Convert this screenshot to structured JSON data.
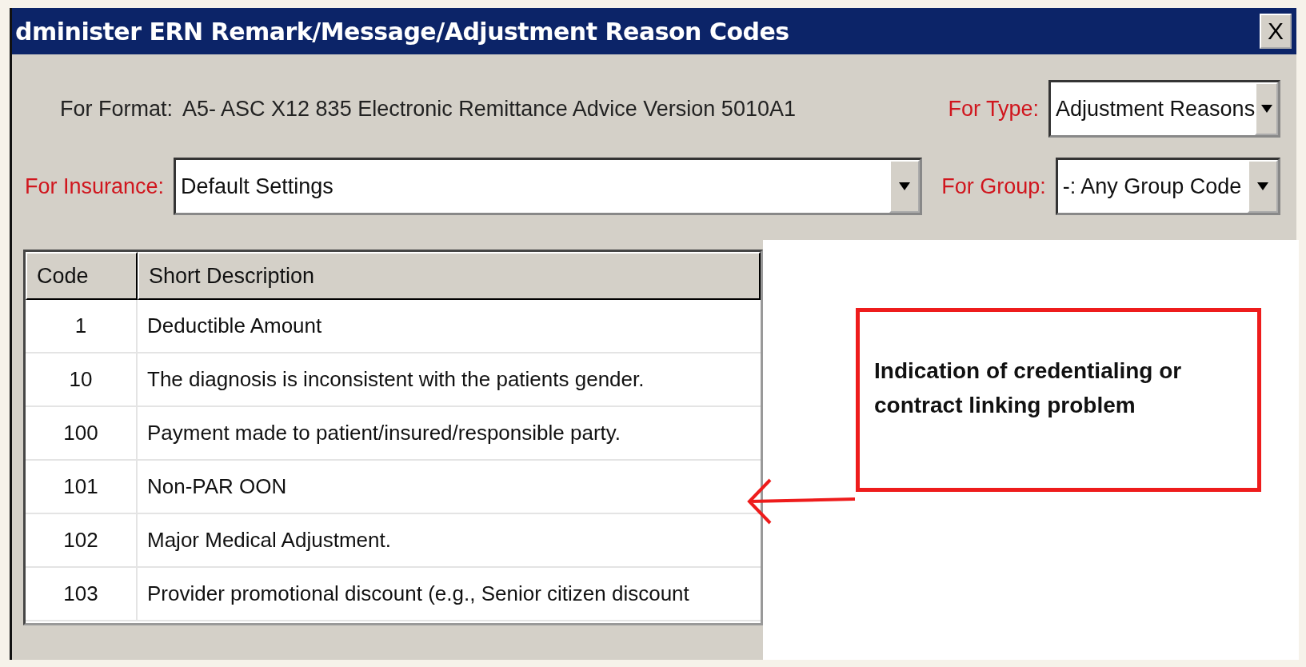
{
  "window": {
    "title": "dminister ERN Remark/Message/Adjustment Reason Codes",
    "close": "X"
  },
  "format": {
    "label": "For Format:",
    "value": "A5- ASC X12 835 Electronic Remittance Advice Version 5010A1"
  },
  "type": {
    "label": "For Type:",
    "value": "Adjustment Reasons"
  },
  "insurance": {
    "label": "For Insurance:",
    "value": "Default Settings"
  },
  "group": {
    "label": "For Group:",
    "value": "-: Any Group Code"
  },
  "table": {
    "columns": [
      "Code",
      "Short Description"
    ],
    "rows": [
      {
        "code": "1",
        "description": "Deductible Amount"
      },
      {
        "code": "10",
        "description": "The diagnosis is inconsistent with the patients gender."
      },
      {
        "code": "100",
        "description": "Payment made to patient/insured/responsible party."
      },
      {
        "code": "101",
        "description": "Non-PAR OON"
      },
      {
        "code": "102",
        "description": "Major Medical Adjustment."
      },
      {
        "code": "103",
        "description": "Provider promotional discount (e.g., Senior citizen discount"
      }
    ]
  },
  "annotation": {
    "text": "Indication of credentialing or\ncontract linking problem"
  }
}
